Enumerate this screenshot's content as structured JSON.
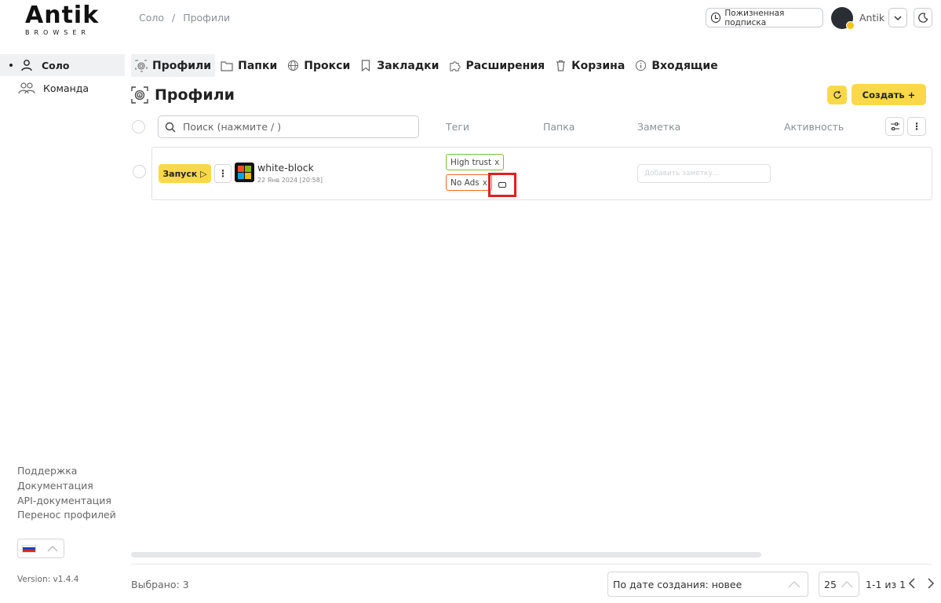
{
  "app": {
    "logo_main": "Antik",
    "logo_sub": "BROWSER"
  },
  "breadcrumb": [
    "Соло",
    "/",
    "Профили"
  ],
  "header": {
    "subscription_label": "Пожизненная подписка",
    "username": "Antik"
  },
  "sidebar": {
    "items": [
      {
        "label": "Соло",
        "active": true
      },
      {
        "label": "Команда",
        "active": false
      }
    ],
    "links": [
      "Поддержка",
      "Документация",
      "API-документация",
      "Перенос профилей"
    ],
    "version": "Version: v1.4.4"
  },
  "nav": {
    "tabs": [
      {
        "label": "Профили",
        "icon": "fingerprint-icon",
        "active": true
      },
      {
        "label": "Папки",
        "icon": "folder-icon"
      },
      {
        "label": "Прокси",
        "icon": "globe-icon"
      },
      {
        "label": "Закладки",
        "icon": "bookmark-icon"
      },
      {
        "label": "Расширения",
        "icon": "puzzle-icon"
      },
      {
        "label": "Корзина",
        "icon": "trash-icon"
      },
      {
        "label": "Входящие",
        "icon": "info-icon"
      }
    ]
  },
  "page": {
    "title": "Профили",
    "create_label": "Создать +"
  },
  "table": {
    "search_placeholder": "Поиск (нажмите / )",
    "columns": {
      "tags": "Теги",
      "folder": "Папка",
      "note": "Заметка",
      "activity": "Активность"
    },
    "rows": [
      {
        "launch_label": "Запуск ▷",
        "name": "white-block",
        "date": "22 Янв 2024 [20:58]",
        "tags": [
          {
            "label": "High trust",
            "color": "#7cbf3a"
          },
          {
            "label": "No Ads",
            "color": "#f26a2e"
          }
        ],
        "note_placeholder": "Добавить заметку..."
      }
    ]
  },
  "footer": {
    "selected": "Выбрано: 3",
    "sort": "По дате создания: новее",
    "per_page": "25",
    "range": "1-1 из 1"
  },
  "colors": {
    "accent": "#fbd84a",
    "highlight": "#e02020"
  }
}
